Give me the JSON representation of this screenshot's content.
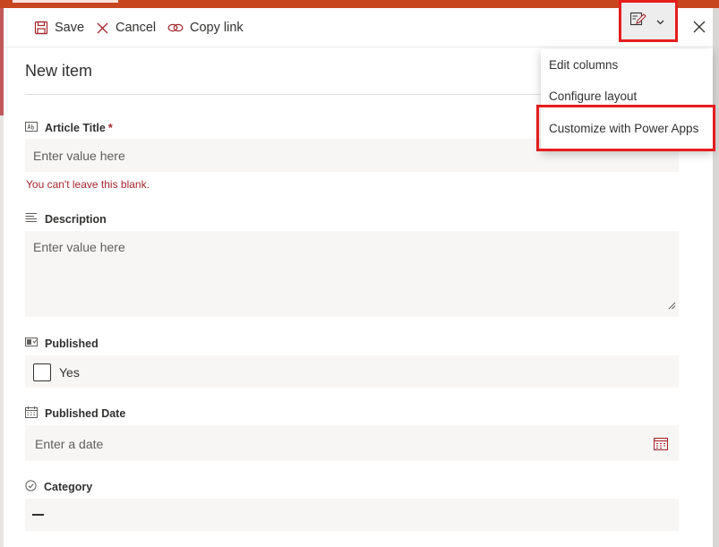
{
  "toolbar": {
    "save_label": "Save",
    "cancel_label": "Cancel",
    "copy_link_label": "Copy link",
    "form_menu_icon": "edit-form-icon",
    "close_icon": "close-icon"
  },
  "form": {
    "title": "New item",
    "article_title": {
      "label": "Article Title",
      "required_mark": "*",
      "placeholder": "Enter value here",
      "error": "You can't leave this blank.",
      "icon": "text-field-icon"
    },
    "description": {
      "label": "Description",
      "placeholder": "Enter value here",
      "icon": "multiline-text-icon"
    },
    "published": {
      "label": "Published",
      "option_label": "Yes",
      "checked": false,
      "icon": "toggle-field-icon"
    },
    "published_date": {
      "label": "Published Date",
      "placeholder": "Enter a date",
      "icon": "calendar-icon"
    },
    "category": {
      "label": "Category",
      "value": "—",
      "icon": "choice-check-icon"
    }
  },
  "dropdown_menu": {
    "items": [
      {
        "label": "Edit columns"
      },
      {
        "label": "Configure layout"
      },
      {
        "label": "Customize with Power Apps",
        "highlighted": true
      }
    ]
  },
  "colors": {
    "accent_red": "#a4262c",
    "annotation_red": "#e51d1d",
    "field_background": "#f7f6f5",
    "top_bar": "#c8461f"
  }
}
